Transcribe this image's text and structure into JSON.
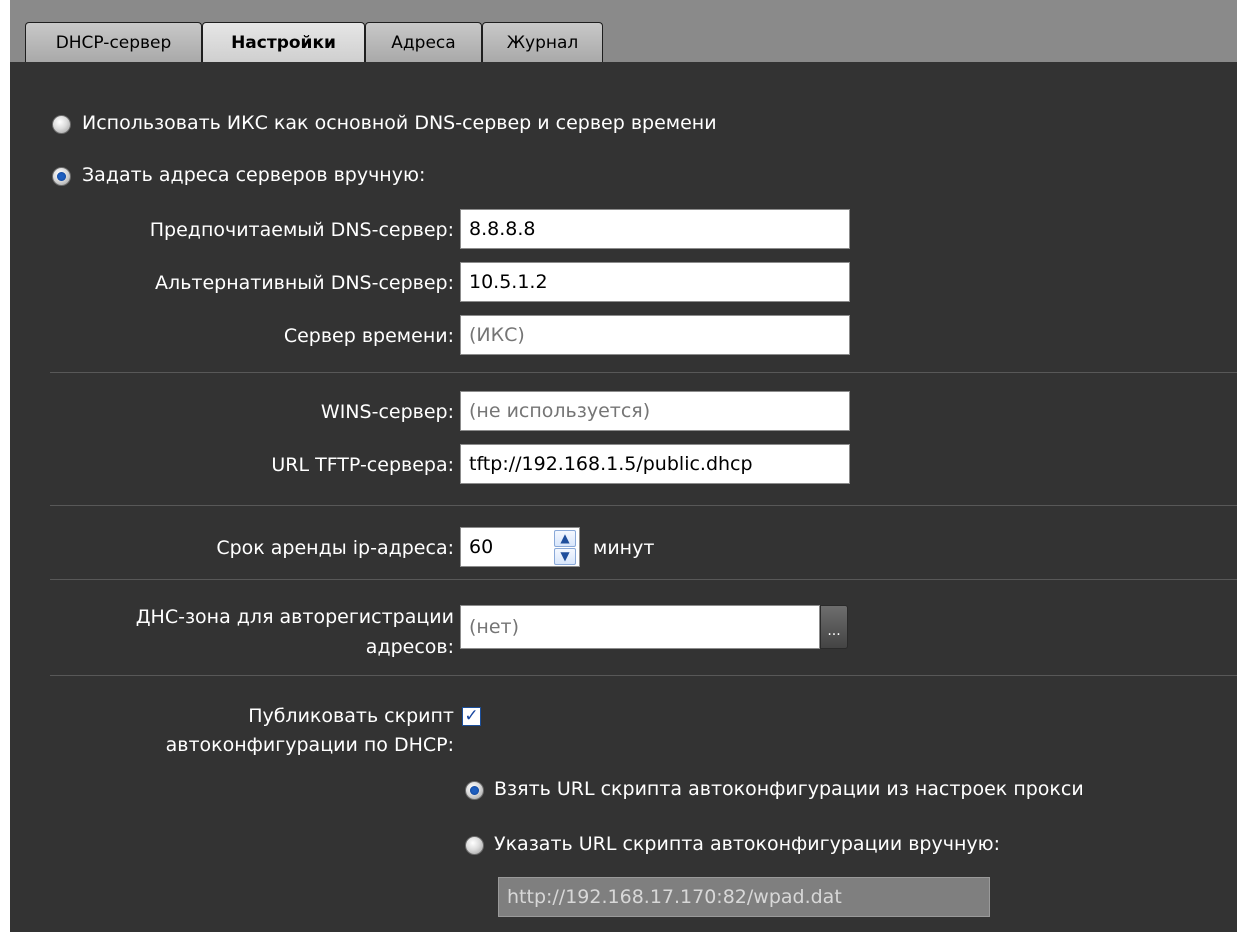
{
  "tabs": [
    {
      "label": "DHCP-сервер",
      "active": false
    },
    {
      "label": "Настройки",
      "active": true
    },
    {
      "label": "Адреса",
      "active": false
    },
    {
      "label": "Журнал",
      "active": false
    }
  ],
  "dns_mode": {
    "use_iks_label": "Использовать ИКС как основной DNS-сервер и сервер времени",
    "use_iks_checked": false,
    "manual_label": "Задать адреса серверов вручную:",
    "manual_checked": true
  },
  "fields": {
    "preferred_dns": {
      "label": "Предпочитаемый DNS-сервер:",
      "value": "8.8.8.8"
    },
    "alternate_dns": {
      "label": "Альтернативный DNS-сервер:",
      "value": "10.5.1.2"
    },
    "time_server": {
      "label": "Сервер времени:",
      "placeholder": "(ИКС)"
    },
    "wins_server": {
      "label": "WINS-сервер:",
      "placeholder": "(не используется)"
    },
    "tftp_url": {
      "label": "URL TFTP-сервера:",
      "value": "tftp://192.168.1.5/public.dhcp"
    }
  },
  "lease": {
    "label": "Срок аренды ip-адреса:",
    "value": "60",
    "unit": "минут"
  },
  "dns_zone": {
    "label_line1": "ДНС-зона для авторегистрации",
    "label_line2": "адресов:",
    "placeholder": "(нет)",
    "button": "..."
  },
  "autoconfig": {
    "label_line1": "Публиковать скрипт",
    "label_line2": "автоконфигурации по DHCP:",
    "checked": true,
    "from_proxy_label": "Взять URL скрипта автоконфигурации из настроек прокси",
    "from_proxy_checked": true,
    "manual_label": "Указать URL скрипта автоконфигурации вручную:",
    "manual_checked": false,
    "manual_url": "http://192.168.17.170:82/wpad.dat"
  },
  "colors": {
    "panel": "#333333",
    "tabbar": "#8a8a8a",
    "radio_accent": "#1f5fbf"
  }
}
